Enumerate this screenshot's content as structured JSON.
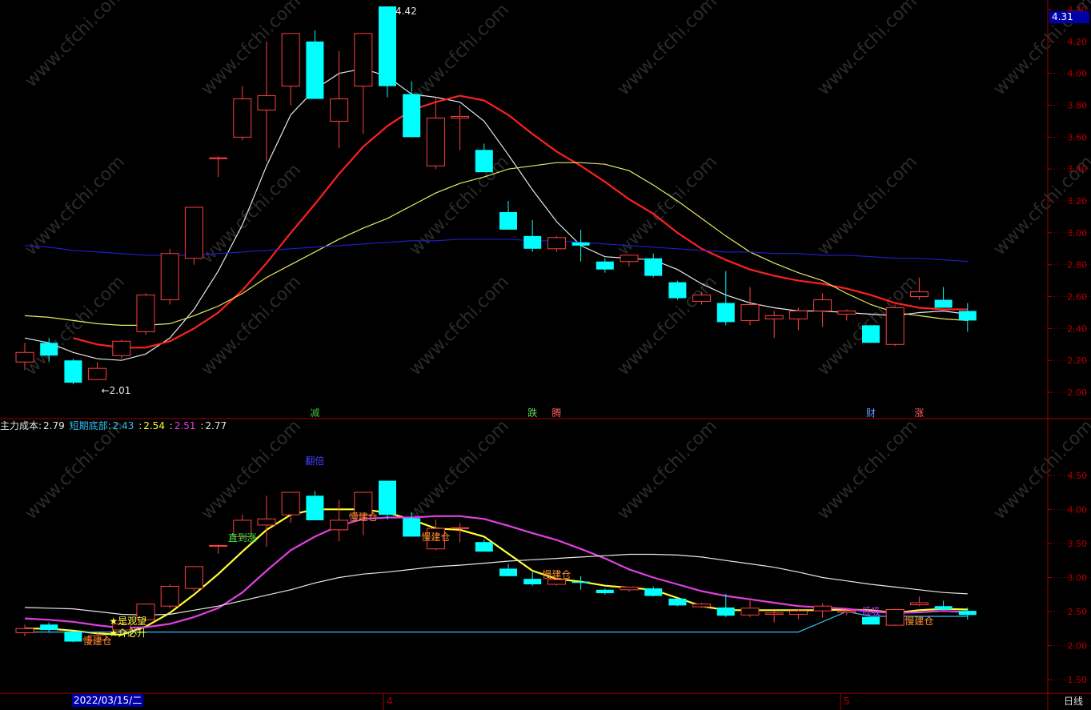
{
  "chart_data": [
    {
      "type": "candlestick",
      "panel": "main",
      "ylim": [
        1.92,
        4.42
      ],
      "y_ticks": [
        "2.00",
        "2.20",
        "2.40",
        "2.60",
        "2.80",
        "3.00",
        "3.20",
        "3.40",
        "3.60",
        "3.80",
        "4.00",
        "4.20",
        "4.40"
      ],
      "current_price": "4.31",
      "max_label": "4.42",
      "min_label": "←2.01",
      "candles": [
        {
          "o": 2.19,
          "h": 2.31,
          "l": 2.14,
          "c": 2.25,
          "up": true
        },
        {
          "o": 2.31,
          "h": 2.34,
          "l": 2.19,
          "c": 2.23,
          "up": false
        },
        {
          "o": 2.2,
          "h": 2.21,
          "l": 2.05,
          "c": 2.06,
          "up": false
        },
        {
          "o": 2.08,
          "h": 2.19,
          "l": 2.08,
          "c": 2.15,
          "up": true
        },
        {
          "o": 2.23,
          "h": 2.33,
          "l": 2.21,
          "c": 2.32,
          "up": true
        },
        {
          "o": 2.38,
          "h": 2.62,
          "l": 2.36,
          "c": 2.61,
          "up": true
        },
        {
          "o": 2.58,
          "h": 2.9,
          "l": 2.55,
          "c": 2.87,
          "up": true
        },
        {
          "o": 2.84,
          "h": 3.16,
          "l": 2.8,
          "c": 3.16,
          "up": true
        },
        {
          "o": 3.47,
          "h": 3.48,
          "l": 3.35,
          "c": 3.47,
          "up": true
        },
        {
          "o": 3.6,
          "h": 3.92,
          "l": 3.58,
          "c": 3.84,
          "up": true
        },
        {
          "o": 3.77,
          "h": 4.2,
          "l": 3.45,
          "c": 3.86,
          "up": true
        },
        {
          "o": 3.92,
          "h": 4.25,
          "l": 3.8,
          "c": 4.25,
          "up": true
        },
        {
          "o": 4.2,
          "h": 4.27,
          "l": 3.85,
          "c": 3.84,
          "up": false
        },
        {
          "o": 3.7,
          "h": 4.14,
          "l": 3.53,
          "c": 3.84,
          "up": true
        },
        {
          "o": 3.92,
          "h": 4.25,
          "l": 3.62,
          "c": 4.25,
          "up": true
        },
        {
          "o": 4.42,
          "h": 4.42,
          "l": 3.85,
          "c": 3.92,
          "up": false
        },
        {
          "o": 3.87,
          "h": 3.95,
          "l": 3.6,
          "c": 3.6,
          "up": false
        },
        {
          "o": 3.42,
          "h": 3.85,
          "l": 3.4,
          "c": 3.72,
          "up": true
        },
        {
          "o": 3.72,
          "h": 3.8,
          "l": 3.52,
          "c": 3.73,
          "up": true
        },
        {
          "o": 3.52,
          "h": 3.56,
          "l": 3.38,
          "c": 3.38,
          "up": false
        },
        {
          "o": 3.13,
          "h": 3.2,
          "l": 3.02,
          "c": 3.02,
          "up": false
        },
        {
          "o": 2.98,
          "h": 3.08,
          "l": 2.88,
          "c": 2.9,
          "up": false
        },
        {
          "o": 2.9,
          "h": 2.98,
          "l": 2.88,
          "c": 2.97,
          "up": true
        },
        {
          "o": 2.94,
          "h": 3.02,
          "l": 2.82,
          "c": 2.92,
          "up": false
        },
        {
          "o": 2.82,
          "h": 2.84,
          "l": 2.75,
          "c": 2.77,
          "up": false
        },
        {
          "o": 2.82,
          "h": 2.86,
          "l": 2.79,
          "c": 2.86,
          "up": true
        },
        {
          "o": 2.84,
          "h": 2.87,
          "l": 2.72,
          "c": 2.73,
          "up": false
        },
        {
          "o": 2.69,
          "h": 2.7,
          "l": 2.58,
          "c": 2.59,
          "up": false
        },
        {
          "o": 2.57,
          "h": 2.63,
          "l": 2.55,
          "c": 2.61,
          "up": true
        },
        {
          "o": 2.56,
          "h": 2.76,
          "l": 2.42,
          "c": 2.44,
          "up": false
        },
        {
          "o": 2.45,
          "h": 2.66,
          "l": 2.42,
          "c": 2.55,
          "up": true
        },
        {
          "o": 2.46,
          "h": 2.51,
          "l": 2.34,
          "c": 2.48,
          "up": true
        },
        {
          "o": 2.46,
          "h": 2.53,
          "l": 2.39,
          "c": 2.51,
          "up": true
        },
        {
          "o": 2.51,
          "h": 2.62,
          "l": 2.41,
          "c": 2.58,
          "up": true
        },
        {
          "o": 2.49,
          "h": 2.52,
          "l": 2.45,
          "c": 2.51,
          "up": true
        },
        {
          "o": 2.42,
          "h": 2.42,
          "l": 2.31,
          "c": 2.31,
          "up": false
        },
        {
          "o": 2.3,
          "h": 2.54,
          "l": 2.29,
          "c": 2.53,
          "up": true
        },
        {
          "o": 2.6,
          "h": 2.72,
          "l": 2.58,
          "c": 2.63,
          "up": true
        },
        {
          "o": 2.58,
          "h": 2.66,
          "l": 2.53,
          "c": 2.53,
          "up": false
        },
        {
          "o": 2.51,
          "h": 2.56,
          "l": 2.38,
          "c": 2.45,
          "up": false
        }
      ],
      "series": [
        {
          "color": "#e8e8e8",
          "values": [
            2.34,
            2.31,
            2.25,
            2.21,
            2.2,
            2.24,
            2.34,
            2.52,
            2.76,
            3.05,
            3.42,
            3.74,
            3.9,
            4.0,
            4.03,
            3.98,
            3.87,
            3.85,
            3.82,
            3.7,
            3.49,
            3.27,
            3.07,
            2.92,
            2.85,
            2.84,
            2.83,
            2.77,
            2.68,
            2.61,
            2.56,
            2.53,
            2.51,
            2.51,
            2.5,
            2.49,
            2.48,
            2.5,
            2.51,
            2.49
          ]
        },
        {
          "color": "#ff2020",
          "values": [
            null,
            null,
            2.34,
            2.3,
            2.28,
            2.28,
            2.32,
            2.4,
            2.5,
            2.64,
            2.81,
            3.0,
            3.18,
            3.37,
            3.54,
            3.67,
            3.77,
            3.82,
            3.86,
            3.83,
            3.74,
            3.62,
            3.51,
            3.42,
            3.32,
            3.21,
            3.12,
            3.0,
            2.9,
            2.83,
            2.77,
            2.73,
            2.7,
            2.68,
            2.65,
            2.61,
            2.56,
            2.53,
            2.52,
            2.52
          ]
        },
        {
          "color": "#e8e860",
          "values": [
            2.48,
            2.47,
            2.45,
            2.43,
            2.42,
            2.42,
            2.43,
            2.48,
            2.54,
            2.62,
            2.72,
            2.8,
            2.88,
            2.96,
            3.03,
            3.09,
            3.17,
            3.25,
            3.31,
            3.35,
            3.4,
            3.42,
            3.44,
            3.44,
            3.43,
            3.39,
            3.3,
            3.2,
            3.09,
            2.98,
            2.88,
            2.81,
            2.75,
            2.7,
            2.62,
            2.55,
            2.5,
            2.48,
            2.46,
            2.45
          ]
        },
        {
          "color": "#2020d0",
          "values": [
            2.92,
            2.91,
            2.89,
            2.88,
            2.87,
            2.86,
            2.86,
            2.86,
            2.87,
            2.88,
            2.89,
            2.9,
            2.91,
            2.92,
            2.93,
            2.94,
            2.95,
            2.95,
            2.96,
            2.96,
            2.96,
            2.95,
            2.95,
            2.94,
            2.93,
            2.92,
            2.91,
            2.9,
            2.89,
            2.88,
            2.88,
            2.87,
            2.87,
            2.86,
            2.86,
            2.85,
            2.84,
            2.84,
            2.83,
            2.82
          ]
        }
      ],
      "annotations": [
        {
          "text": "减",
          "idx": 12,
          "color": "#40c040"
        },
        {
          "text": "跌",
          "idx": 21,
          "color": "#60e060"
        },
        {
          "text": "腾",
          "idx": 22,
          "color": "#ff6060"
        },
        {
          "text": "财",
          "idx": 35,
          "color": "#60a0ff"
        },
        {
          "text": "涨",
          "idx": 37,
          "color": "#ff6060"
        }
      ]
    },
    {
      "type": "candlestick",
      "panel": "indicator",
      "ylim": [
        1.42,
        4.92
      ],
      "y_ticks": [
        "1.50",
        "2.00",
        "2.50",
        "3.00",
        "3.50",
        "4.00",
        "4.50"
      ],
      "series": [
        {
          "color": "#ffff30",
          "values": [
            2.25,
            2.25,
            2.22,
            2.18,
            2.16,
            2.28,
            2.48,
            2.75,
            3.05,
            3.38,
            3.7,
            3.92,
            4.0,
            4.0,
            4.0,
            3.95,
            3.85,
            3.72,
            3.7,
            3.6,
            3.35,
            3.1,
            2.98,
            2.94,
            2.88,
            2.85,
            2.82,
            2.7,
            2.58,
            2.52,
            2.52,
            2.52,
            2.52,
            2.52,
            2.53,
            2.52,
            2.48,
            2.52,
            2.54,
            2.53
          ]
        },
        {
          "color": "#e040e0",
          "values": [
            2.4,
            2.38,
            2.35,
            2.3,
            2.26,
            2.27,
            2.32,
            2.42,
            2.55,
            2.78,
            3.1,
            3.4,
            3.6,
            3.76,
            3.86,
            3.88,
            3.88,
            3.9,
            3.9,
            3.86,
            3.76,
            3.65,
            3.55,
            3.42,
            3.28,
            3.12,
            3.0,
            2.9,
            2.8,
            2.73,
            2.68,
            2.63,
            2.58,
            2.56,
            2.54,
            2.5,
            2.48,
            2.49,
            2.51,
            2.49
          ]
        },
        {
          "color": "#e8e8e8",
          "values": [
            2.56,
            2.55,
            2.54,
            2.5,
            2.46,
            2.45,
            2.46,
            2.52,
            2.58,
            2.66,
            2.74,
            2.82,
            2.92,
            3.0,
            3.05,
            3.08,
            3.12,
            3.16,
            3.18,
            3.21,
            3.24,
            3.26,
            3.28,
            3.3,
            3.32,
            3.34,
            3.34,
            3.33,
            3.3,
            3.25,
            3.2,
            3.15,
            3.08,
            3.0,
            2.95,
            2.9,
            2.86,
            2.82,
            2.78,
            2.76
          ]
        },
        {
          "color": "#30c0f0",
          "values": [
            2.2,
            2.2,
            2.2,
            2.2,
            2.2,
            2.2,
            2.2,
            2.2,
            2.2,
            2.2,
            2.2,
            2.2,
            2.2,
            2.2,
            2.2,
            2.2,
            2.2,
            2.2,
            2.2,
            2.2,
            2.2,
            2.2,
            2.2,
            2.2,
            2.2,
            2.2,
            2.2,
            2.2,
            2.2,
            2.2,
            2.2,
            2.2,
            2.2,
            2.35,
            2.5,
            2.43,
            2.43,
            2.43,
            2.43,
            2.43
          ]
        }
      ],
      "annotations": [
        {
          "text": "慢建仓",
          "idx": 3,
          "color": "#ff9030"
        },
        {
          "text": "★是观望",
          "idx": 4,
          "color": "#ffff40"
        },
        {
          "text": "★介必升",
          "idx": 4,
          "color": "#ffff40"
        },
        {
          "text": "直到涨",
          "idx": 9,
          "color": "#40e040"
        },
        {
          "text": "翻倍",
          "idx": 12,
          "color": "#4040ff"
        },
        {
          "text": "慢建仓",
          "idx": 14,
          "color": "#ff9030"
        },
        {
          "text": "慢建仓",
          "idx": 17,
          "color": "#ff9030"
        },
        {
          "text": "慢建仓",
          "idx": 22,
          "color": "#ff9030"
        },
        {
          "text": "低吸",
          "idx": 35,
          "color": "#c040ff"
        },
        {
          "text": "慢建仓",
          "idx": 37,
          "color": "#ff9030"
        }
      ]
    }
  ],
  "legend": {
    "main_cost_label": "主力成本:",
    "main_cost_value": "2.79",
    "short_bottom_label": "短期底部:",
    "short_bottom_value": "2.43",
    "v3": "2.54",
    "v4": "2.51",
    "v5": "2.77",
    "sep": ":"
  },
  "x_axis": {
    "date_label": "2022/03/15/二",
    "month_ticks": [
      "4",
      "5"
    ],
    "timeframe": "日线"
  },
  "watermark": "www.cfchi.com"
}
